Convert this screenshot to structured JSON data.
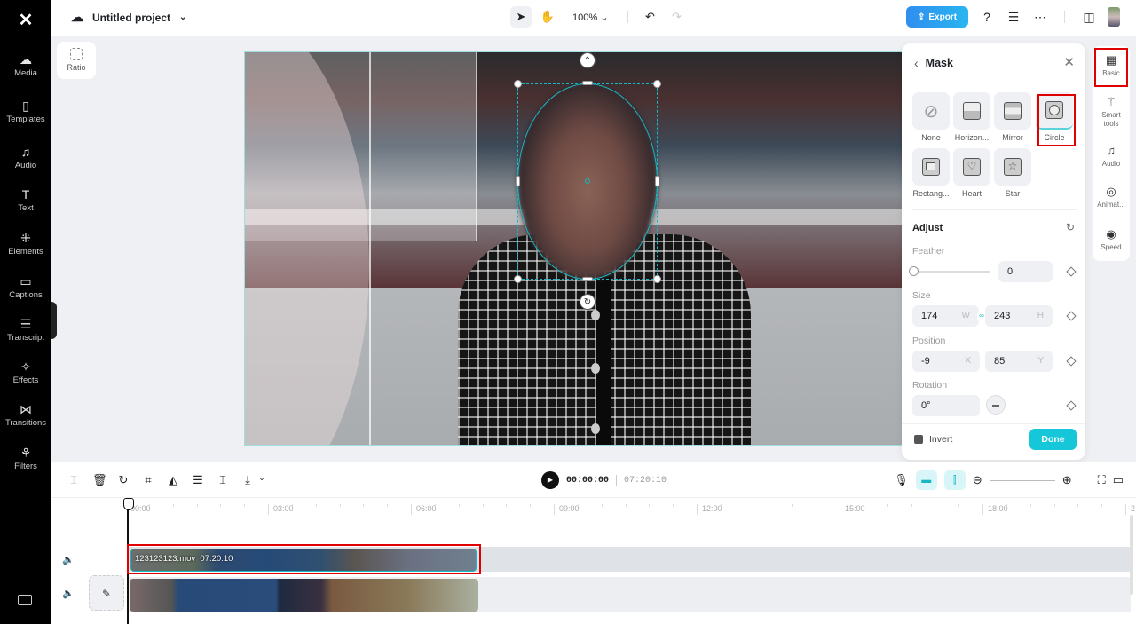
{
  "app": {
    "logo": "capcut-logo"
  },
  "sidebar": {
    "items": [
      {
        "label": "Media",
        "icon": "cloud-upload-icon",
        "glyph": "☁"
      },
      {
        "label": "Templates",
        "icon": "templates-icon",
        "glyph": "▯"
      },
      {
        "label": "Audio",
        "icon": "music-note-icon",
        "glyph": "♫"
      },
      {
        "label": "Text",
        "icon": "text-icon",
        "glyph": "T"
      },
      {
        "label": "Elements",
        "icon": "elements-icon",
        "glyph": "⁜"
      },
      {
        "label": "Captions",
        "icon": "captions-icon",
        "glyph": "▭"
      },
      {
        "label": "Transcript",
        "icon": "transcript-icon",
        "glyph": "☰"
      },
      {
        "label": "Effects",
        "icon": "effects-icon",
        "glyph": "✧"
      },
      {
        "label": "Transitions",
        "icon": "transitions-icon",
        "glyph": "⋈"
      },
      {
        "label": "Filters",
        "icon": "filters-icon",
        "glyph": "⚘"
      }
    ]
  },
  "topbar": {
    "project_name": "Untitled project",
    "zoom": "100%",
    "export_label": "Export"
  },
  "canvas": {
    "ratio_label": "Ratio"
  },
  "mask_panel": {
    "title": "Mask",
    "shapes": [
      {
        "label": "None",
        "selected": false
      },
      {
        "label": "Horizon...",
        "selected": false
      },
      {
        "label": "Mirror",
        "selected": false
      },
      {
        "label": "Circle",
        "selected": true
      },
      {
        "label": "Rectang...",
        "selected": false
      },
      {
        "label": "Heart",
        "selected": false
      },
      {
        "label": "Star",
        "selected": false
      }
    ],
    "adjust_title": "Adjust",
    "feather": {
      "label": "Feather",
      "value": "0",
      "slider_fraction": 0
    },
    "size": {
      "label": "Size",
      "w": "174",
      "w_suffix": "W",
      "h": "243",
      "h_suffix": "H"
    },
    "position": {
      "label": "Position",
      "x": "-9",
      "x_suffix": "X",
      "y": "85",
      "y_suffix": "Y"
    },
    "rotation": {
      "label": "Rotation",
      "value": "0°"
    },
    "invert_label": "Invert",
    "done_label": "Done"
  },
  "property_rail": {
    "items": [
      {
        "label": "Basic",
        "active": true
      },
      {
        "label": "Smart tools"
      },
      {
        "label": "Audio"
      },
      {
        "label": "Animat..."
      },
      {
        "label": "Speed"
      }
    ]
  },
  "timeline": {
    "current_time": "00:00:00",
    "duration": "07:20:10",
    "ruler": [
      "00:00",
      "03:00",
      "06:00",
      "09:00",
      "12:00",
      "15:00",
      "18:00",
      "2"
    ],
    "clip1": {
      "name": "123123123.mov",
      "duration": "07:20:10"
    }
  }
}
